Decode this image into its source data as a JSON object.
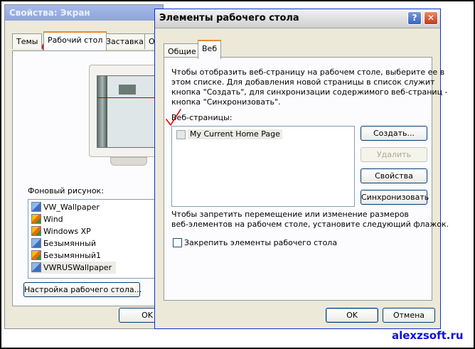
{
  "back_window": {
    "title": "Свойства: Экран",
    "tabs": [
      "Темы",
      "Рабочий стол",
      "Заставка",
      "Оф"
    ],
    "background_label": "Фоновый рисунок:",
    "backgrounds": [
      "VW_Wallpaper",
      "Wind",
      "Windows XP",
      "Безымянный",
      "Безымянный1",
      "VWRUSWallpaper"
    ],
    "customize_button": "Настройка рабочего стола...",
    "ok_button": "OK"
  },
  "dialog": {
    "title": "Элементы рабочего стола",
    "help_glyph": "?",
    "close_glyph": "✕",
    "tabs": [
      "Общие",
      "Веб"
    ],
    "intro_lines": [
      "Чтобы отобразить веб-страницу на рабочем столе, выберите ее в",
      "этом списке. Для добавления новой страницы в список служит",
      "кнопка \"Создать\", для синхронизации содержимого веб-страниц -",
      "кнопка \"Синхронизовать\"."
    ],
    "web_pages_label": "Веб-страницы:",
    "web_pages": [
      "My Current Home Page"
    ],
    "buttons": {
      "create": "Создать...",
      "delete": "Удалить",
      "properties": "Свойства",
      "sync": "Синхронизовать"
    },
    "lock_text_lines": [
      "Чтобы запретить перемещение или изменение размеров",
      "веб-элементов на рабочем столе, установите следующий флажок."
    ],
    "lock_checkbox_label": "Закрепить элементы рабочего стола",
    "ok_button": "OK",
    "cancel_button": "Отмена"
  },
  "watermark": "alexzsoft.ru",
  "annotation_color": "#e00000"
}
